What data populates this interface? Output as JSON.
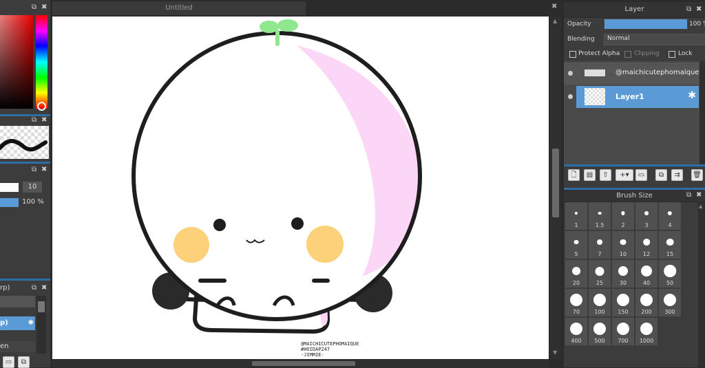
{
  "canvas": {
    "tab_title": "Untitled",
    "watermark": [
      "@MAICHICUTEPHOMAIQUE",
      "#HOIDAP247",
      "-JIMMIE-"
    ]
  },
  "left": {
    "brush_value": "10",
    "opacity_value": "100 %",
    "layer_rows": [
      "rp)",
      "p)",
      "en"
    ]
  },
  "layer_panel": {
    "title": "Layer",
    "opacity_label": "Opacity",
    "opacity_value": "100 %",
    "opacity_level": 1.0,
    "blending_label": "Blending",
    "blending_value": "Normal",
    "protect_alpha": "Protect Alpha",
    "clipping": "Clipping",
    "lock": "Lock",
    "layers": [
      {
        "name": "@maichicutephomaique",
        "selected": false
      },
      {
        "name": "Layer1",
        "selected": true
      }
    ]
  },
  "brush_panel": {
    "title": "Brush Size",
    "sizes": [
      "1",
      "1.5",
      "2",
      "3",
      "4",
      "5",
      "7",
      "10",
      "12",
      "15",
      "20",
      "25",
      "30",
      "40",
      "50",
      "70",
      "100",
      "150",
      "200",
      "300",
      "400",
      "500",
      "700",
      "1000"
    ]
  },
  "colors": {
    "accent": "#5b9bd5",
    "outline": "#1e1e1e",
    "cheek": "#fdd07a",
    "shade": "#fbd6f7",
    "sprout": "#8fe88e"
  }
}
